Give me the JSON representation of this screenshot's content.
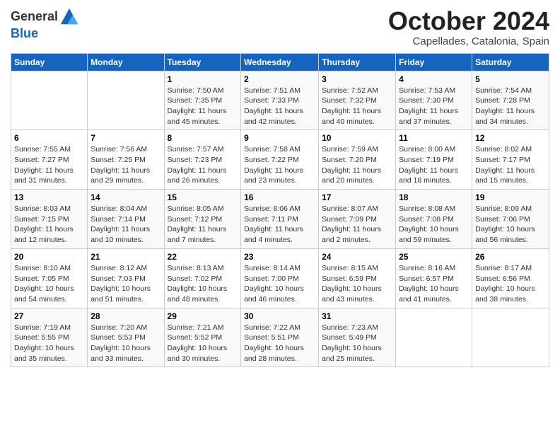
{
  "header": {
    "logo_general": "General",
    "logo_blue": "Blue",
    "month": "October 2024",
    "location": "Capellades, Catalonia, Spain"
  },
  "days_of_week": [
    "Sunday",
    "Monday",
    "Tuesday",
    "Wednesday",
    "Thursday",
    "Friday",
    "Saturday"
  ],
  "weeks": [
    [
      {
        "day": "",
        "detail": ""
      },
      {
        "day": "",
        "detail": ""
      },
      {
        "day": "1",
        "detail": "Sunrise: 7:50 AM\nSunset: 7:35 PM\nDaylight: 11 hours and 45 minutes."
      },
      {
        "day": "2",
        "detail": "Sunrise: 7:51 AM\nSunset: 7:33 PM\nDaylight: 11 hours and 42 minutes."
      },
      {
        "day": "3",
        "detail": "Sunrise: 7:52 AM\nSunset: 7:32 PM\nDaylight: 11 hours and 40 minutes."
      },
      {
        "day": "4",
        "detail": "Sunrise: 7:53 AM\nSunset: 7:30 PM\nDaylight: 11 hours and 37 minutes."
      },
      {
        "day": "5",
        "detail": "Sunrise: 7:54 AM\nSunset: 7:28 PM\nDaylight: 11 hours and 34 minutes."
      }
    ],
    [
      {
        "day": "6",
        "detail": "Sunrise: 7:55 AM\nSunset: 7:27 PM\nDaylight: 11 hours and 31 minutes."
      },
      {
        "day": "7",
        "detail": "Sunrise: 7:56 AM\nSunset: 7:25 PM\nDaylight: 11 hours and 29 minutes."
      },
      {
        "day": "8",
        "detail": "Sunrise: 7:57 AM\nSunset: 7:23 PM\nDaylight: 11 hours and 26 minutes."
      },
      {
        "day": "9",
        "detail": "Sunrise: 7:58 AM\nSunset: 7:22 PM\nDaylight: 11 hours and 23 minutes."
      },
      {
        "day": "10",
        "detail": "Sunrise: 7:59 AM\nSunset: 7:20 PM\nDaylight: 11 hours and 20 minutes."
      },
      {
        "day": "11",
        "detail": "Sunrise: 8:00 AM\nSunset: 7:19 PM\nDaylight: 11 hours and 18 minutes."
      },
      {
        "day": "12",
        "detail": "Sunrise: 8:02 AM\nSunset: 7:17 PM\nDaylight: 11 hours and 15 minutes."
      }
    ],
    [
      {
        "day": "13",
        "detail": "Sunrise: 8:03 AM\nSunset: 7:15 PM\nDaylight: 11 hours and 12 minutes."
      },
      {
        "day": "14",
        "detail": "Sunrise: 8:04 AM\nSunset: 7:14 PM\nDaylight: 11 hours and 10 minutes."
      },
      {
        "day": "15",
        "detail": "Sunrise: 8:05 AM\nSunset: 7:12 PM\nDaylight: 11 hours and 7 minutes."
      },
      {
        "day": "16",
        "detail": "Sunrise: 8:06 AM\nSunset: 7:11 PM\nDaylight: 11 hours and 4 minutes."
      },
      {
        "day": "17",
        "detail": "Sunrise: 8:07 AM\nSunset: 7:09 PM\nDaylight: 11 hours and 2 minutes."
      },
      {
        "day": "18",
        "detail": "Sunrise: 8:08 AM\nSunset: 7:08 PM\nDaylight: 10 hours and 59 minutes."
      },
      {
        "day": "19",
        "detail": "Sunrise: 8:09 AM\nSunset: 7:06 PM\nDaylight: 10 hours and 56 minutes."
      }
    ],
    [
      {
        "day": "20",
        "detail": "Sunrise: 8:10 AM\nSunset: 7:05 PM\nDaylight: 10 hours and 54 minutes."
      },
      {
        "day": "21",
        "detail": "Sunrise: 8:12 AM\nSunset: 7:03 PM\nDaylight: 10 hours and 51 minutes."
      },
      {
        "day": "22",
        "detail": "Sunrise: 8:13 AM\nSunset: 7:02 PM\nDaylight: 10 hours and 48 minutes."
      },
      {
        "day": "23",
        "detail": "Sunrise: 8:14 AM\nSunset: 7:00 PM\nDaylight: 10 hours and 46 minutes."
      },
      {
        "day": "24",
        "detail": "Sunrise: 8:15 AM\nSunset: 6:59 PM\nDaylight: 10 hours and 43 minutes."
      },
      {
        "day": "25",
        "detail": "Sunrise: 8:16 AM\nSunset: 6:57 PM\nDaylight: 10 hours and 41 minutes."
      },
      {
        "day": "26",
        "detail": "Sunrise: 8:17 AM\nSunset: 6:56 PM\nDaylight: 10 hours and 38 minutes."
      }
    ],
    [
      {
        "day": "27",
        "detail": "Sunrise: 7:19 AM\nSunset: 5:55 PM\nDaylight: 10 hours and 35 minutes."
      },
      {
        "day": "28",
        "detail": "Sunrise: 7:20 AM\nSunset: 5:53 PM\nDaylight: 10 hours and 33 minutes."
      },
      {
        "day": "29",
        "detail": "Sunrise: 7:21 AM\nSunset: 5:52 PM\nDaylight: 10 hours and 30 minutes."
      },
      {
        "day": "30",
        "detail": "Sunrise: 7:22 AM\nSunset: 5:51 PM\nDaylight: 10 hours and 28 minutes."
      },
      {
        "day": "31",
        "detail": "Sunrise: 7:23 AM\nSunset: 5:49 PM\nDaylight: 10 hours and 25 minutes."
      },
      {
        "day": "",
        "detail": ""
      },
      {
        "day": "",
        "detail": ""
      }
    ]
  ]
}
